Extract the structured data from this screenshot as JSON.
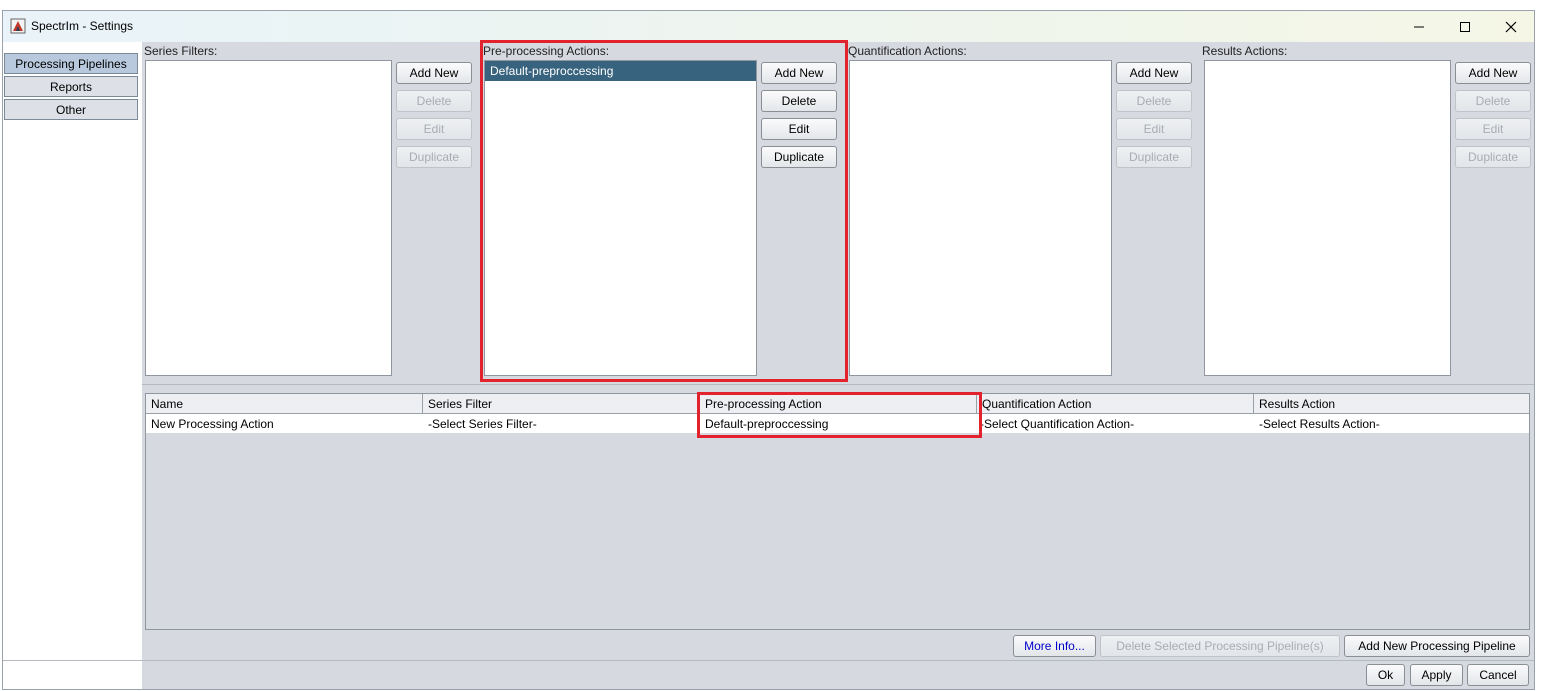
{
  "window": {
    "title": "SpectrIm - Settings",
    "controls": {
      "minimize": "—",
      "maximize": "☐",
      "close": "✕"
    }
  },
  "sidebar": {
    "tabs": [
      {
        "label": "Processing Pipelines",
        "selected": true
      },
      {
        "label": "Reports",
        "selected": false
      },
      {
        "label": "Other",
        "selected": false
      }
    ]
  },
  "panels": {
    "series_filters": {
      "label": "Series Filters:",
      "items": [],
      "buttons": {
        "add": "Add New",
        "delete": "Delete",
        "edit": "Edit",
        "duplicate": "Duplicate"
      }
    },
    "preprocessing": {
      "label": "Pre-processing Actions:",
      "items": [
        "Default-preproccessing"
      ],
      "buttons": {
        "add": "Add New",
        "delete": "Delete",
        "edit": "Edit",
        "duplicate": "Duplicate"
      }
    },
    "quantification": {
      "label": "Quantification Actions:",
      "items": [],
      "buttons": {
        "add": "Add New",
        "delete": "Delete",
        "edit": "Edit",
        "duplicate": "Duplicate"
      }
    },
    "results": {
      "label": "Results Actions:",
      "items": [],
      "buttons": {
        "add": "Add New",
        "delete": "Delete",
        "edit": "Edit",
        "duplicate": "Duplicate"
      }
    }
  },
  "pipeline_table": {
    "columns": [
      "Name",
      "Series Filter",
      "Pre-processing Action",
      "Quantification Action",
      "Results Action"
    ],
    "rows": [
      [
        "New Processing Action",
        "-Select Series Filter-",
        "Default-preproccessing",
        "-Select Quantification Action-",
        "-Select Results Action-"
      ]
    ]
  },
  "pipeline_buttons": {
    "more_info": "More Info...",
    "delete_selected": "Delete Selected Processing Pipeline(s)",
    "add_new": "Add New Processing Pipeline"
  },
  "dialog_buttons": {
    "ok": "Ok",
    "apply": "Apply",
    "cancel": "Cancel"
  },
  "colors": {
    "highlight": "#e2222d",
    "selection": "#38637f",
    "link_text": "#0000cc"
  },
  "icons": {
    "app": "spectrim-app-icon"
  }
}
